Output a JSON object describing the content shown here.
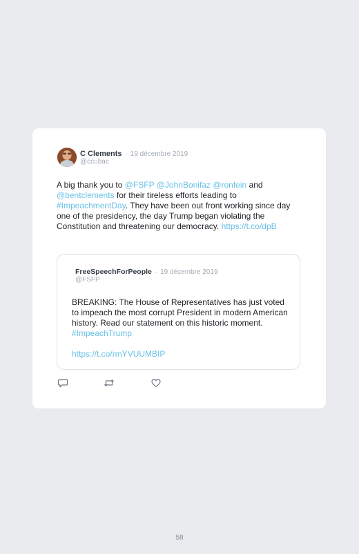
{
  "tweet": {
    "author": "C Clements",
    "separator": "·",
    "date": "19 décembre 2019",
    "handle": "@ccubac",
    "text": {
      "t1": "A big thank you to ",
      "m1": "@FSFP",
      "t2": " ",
      "m2": "@JohnBonifaz",
      "t3": " ",
      "m3": "@ronfein",
      "t4": " and ",
      "m4": "@bentclements",
      "t5": " for their tireless efforts leading to ",
      "h1": "#ImpeachmentDay",
      "t6": ". They have been out front working since day one of the presidency, the day Trump began violating the Constitution and threatening our democracy. ",
      "url": "https://t.co/dpB"
    }
  },
  "quoted": {
    "author": "FreeSpeechForPeople",
    "separator": "·",
    "date": "19 décembre 2019",
    "handle": "@FSFP",
    "text": {
      "t1": "BREAKING: The House of Representatives has just voted to impeach the most corrupt President in modern American history. Read our statement on this historic moment. ",
      "h1": "#ImpeachTrump"
    },
    "url": "https://t.co/rmYVUUMBIP"
  },
  "actions": {
    "icons": [
      "reply-icon",
      "retweet-icon",
      "like-icon"
    ]
  },
  "colors": {
    "background": "#e9ebee",
    "card": "#ffffff",
    "link": "#68c1e8",
    "muted": "#a3aab3"
  },
  "footer": {
    "page_number": "58"
  }
}
